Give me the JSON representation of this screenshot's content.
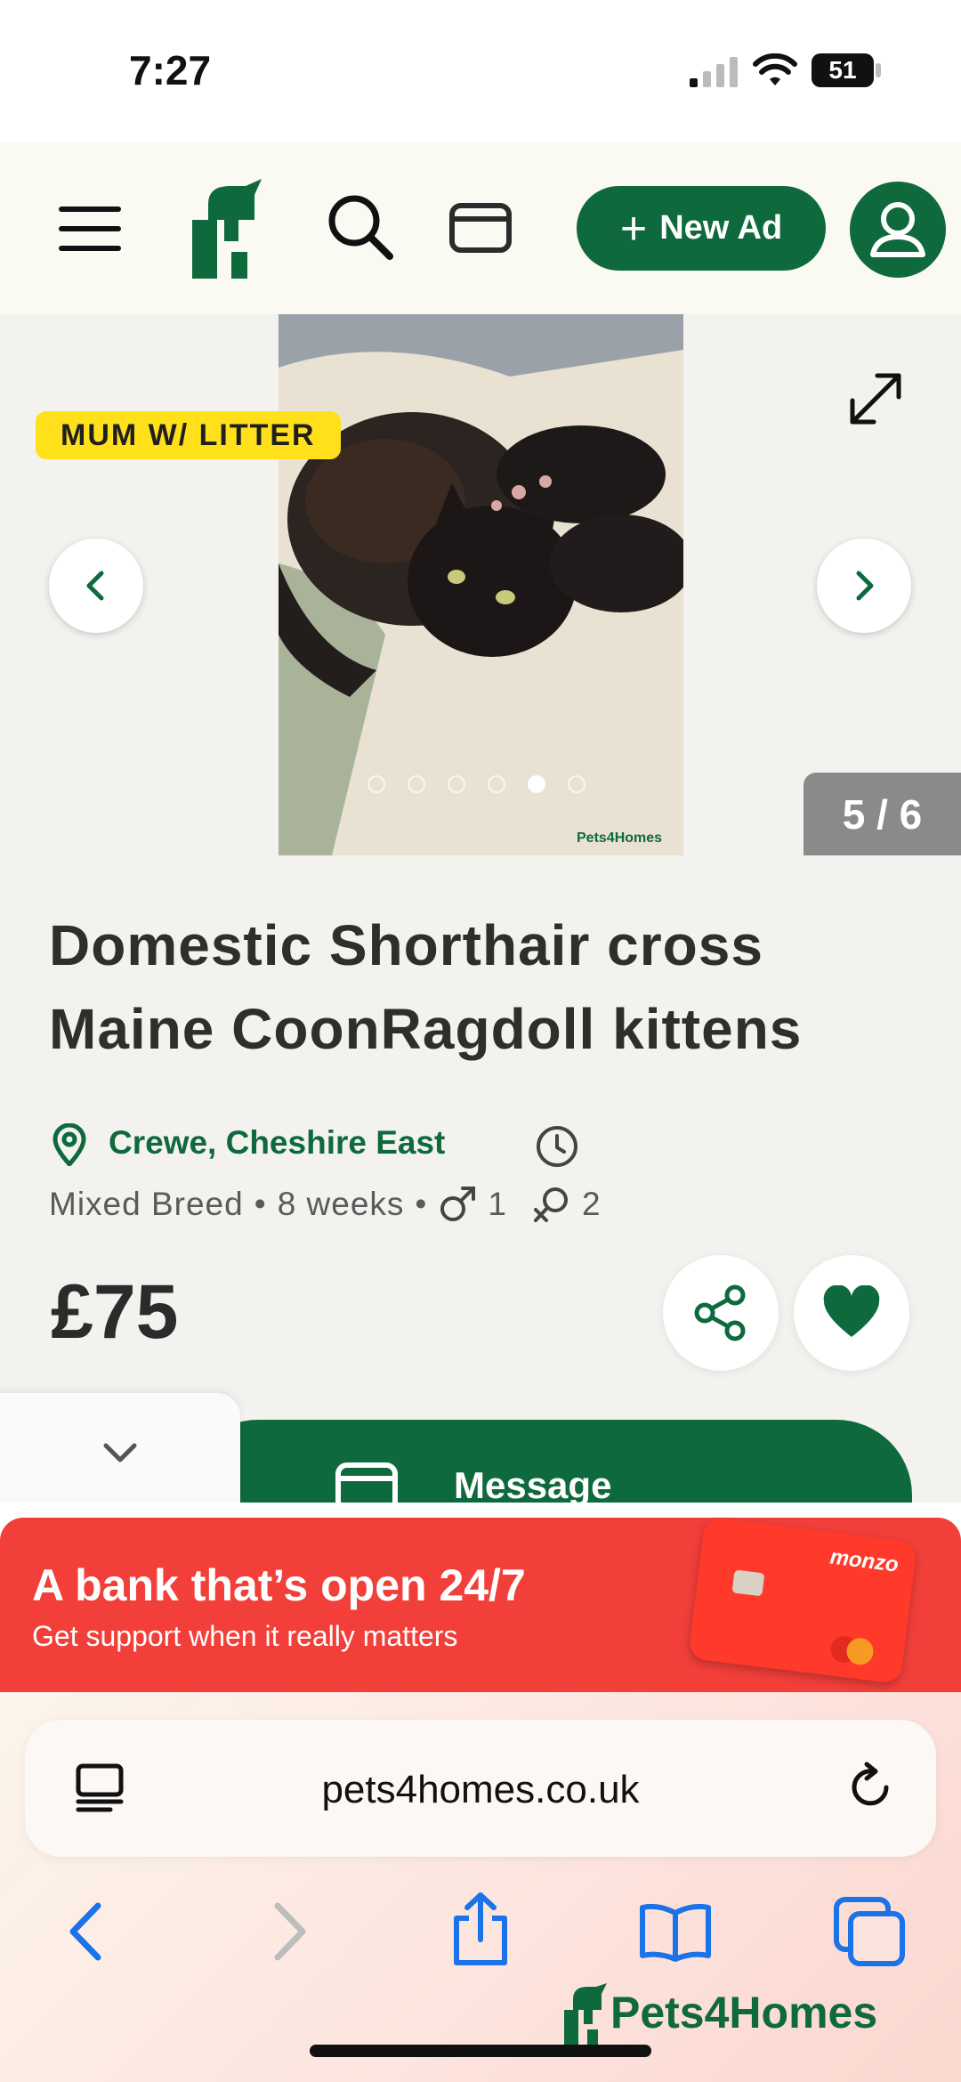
{
  "status_bar": {
    "time": "7:27",
    "battery": "51"
  },
  "header": {
    "new_ad_label": "New Ad"
  },
  "gallery": {
    "badge": "MUM W/ LITTER",
    "counter": "5 / 6",
    "active_dot": 4,
    "dot_count": 6,
    "watermark": "Pets4Homes"
  },
  "listing": {
    "title": "Domestic Shorthair cross Maine CoonRagdoll kittens",
    "location": "Crewe, Cheshire East",
    "breed": "Mixed Breed",
    "age": "8 weeks",
    "males": "1",
    "females": "2",
    "price": "£75",
    "message_label": "Message"
  },
  "ad": {
    "headline": "A bank that’s open 24/7",
    "subline": "Get support when it really matters",
    "card_brand": "monzo"
  },
  "browser": {
    "url": "pets4homes.co.uk",
    "brand_watermark": "Pets4Homes"
  },
  "colors": {
    "brand_green": "#0e6a3c",
    "badge_yellow": "#ffe01a",
    "ad_red": "#f23f3a"
  }
}
